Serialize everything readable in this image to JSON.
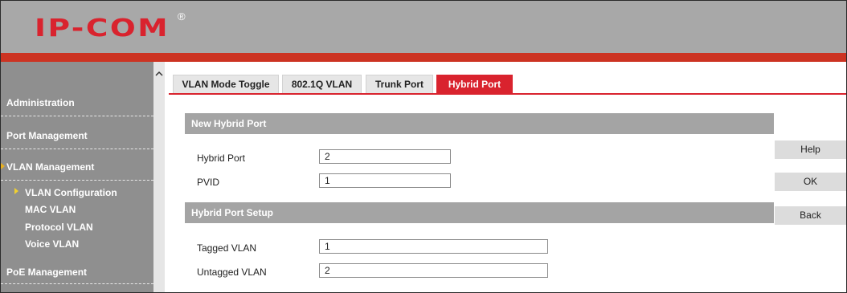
{
  "header": {
    "logo_text": "IP-COM",
    "logo_reg": "®"
  },
  "sidebar": {
    "items": [
      {
        "label": "Administration"
      },
      {
        "label": "Port Management"
      },
      {
        "label": "VLAN Management"
      },
      {
        "label": "VLAN Configuration"
      },
      {
        "label": "MAC VLAN"
      },
      {
        "label": "Protocol VLAN"
      },
      {
        "label": "Voice VLAN"
      },
      {
        "label": "PoE Management"
      }
    ]
  },
  "tabs": [
    {
      "label": "VLAN Mode Toggle"
    },
    {
      "label": "802.1Q VLAN"
    },
    {
      "label": "Trunk Port"
    },
    {
      "label": "Hybrid Port"
    }
  ],
  "new_hybrid_port": {
    "title": "New Hybrid Port",
    "hybrid_port_label": "Hybrid Port",
    "hybrid_port_value": "2",
    "pvid_label": "PVID",
    "pvid_value": "1"
  },
  "hybrid_port_setup": {
    "title": "Hybrid Port Setup",
    "tagged_label": "Tagged VLAN",
    "tagged_value": "1",
    "untagged_label": "Untagged VLAN",
    "untagged_value": "2"
  },
  "buttons": {
    "help": "Help",
    "ok": "OK",
    "back": "Back"
  },
  "colors": {
    "accent": "#d9232e",
    "sidebar": "#8f8f8f",
    "header": "#a8a8a8",
    "section": "#a4a4a4"
  }
}
